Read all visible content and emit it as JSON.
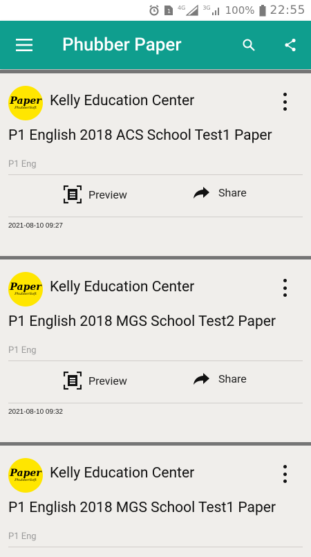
{
  "status_bar": {
    "battery_percent": "100%",
    "time": "22:55",
    "network_labels": [
      "4G",
      "3G"
    ],
    "icons": [
      "alarm-icon",
      "sim-icon",
      "signal-icon",
      "signal-icon",
      "battery-icon"
    ]
  },
  "app_bar": {
    "title": "Phubber Paper",
    "icons": [
      "menu-icon",
      "search-icon",
      "share-icon"
    ],
    "color": "#0f9e8e"
  },
  "cards": [
    {
      "author": "Kelly Education Center",
      "logo_text": "Paper",
      "logo_subtext": "PhubberSoft",
      "title": "P1 English 2018 ACS School Test1 Paper",
      "category": "P1 Eng",
      "preview_label": "Preview",
      "share_label": "Share",
      "date": "2021-08-10 09:27"
    },
    {
      "author": "Kelly Education Center",
      "logo_text": "Paper",
      "logo_subtext": "PhubberSoft",
      "title": "P1 English 2018 MGS School Test2 Paper",
      "category": "P1 Eng",
      "preview_label": "Preview",
      "share_label": "Share",
      "date": "2021-08-10 09:32"
    },
    {
      "author": "Kelly Education Center",
      "logo_text": "Paper",
      "logo_subtext": "PhubberSoft",
      "title": "P1 English 2018 MGS School Test1 Paper",
      "category": "P1 Eng"
    }
  ]
}
